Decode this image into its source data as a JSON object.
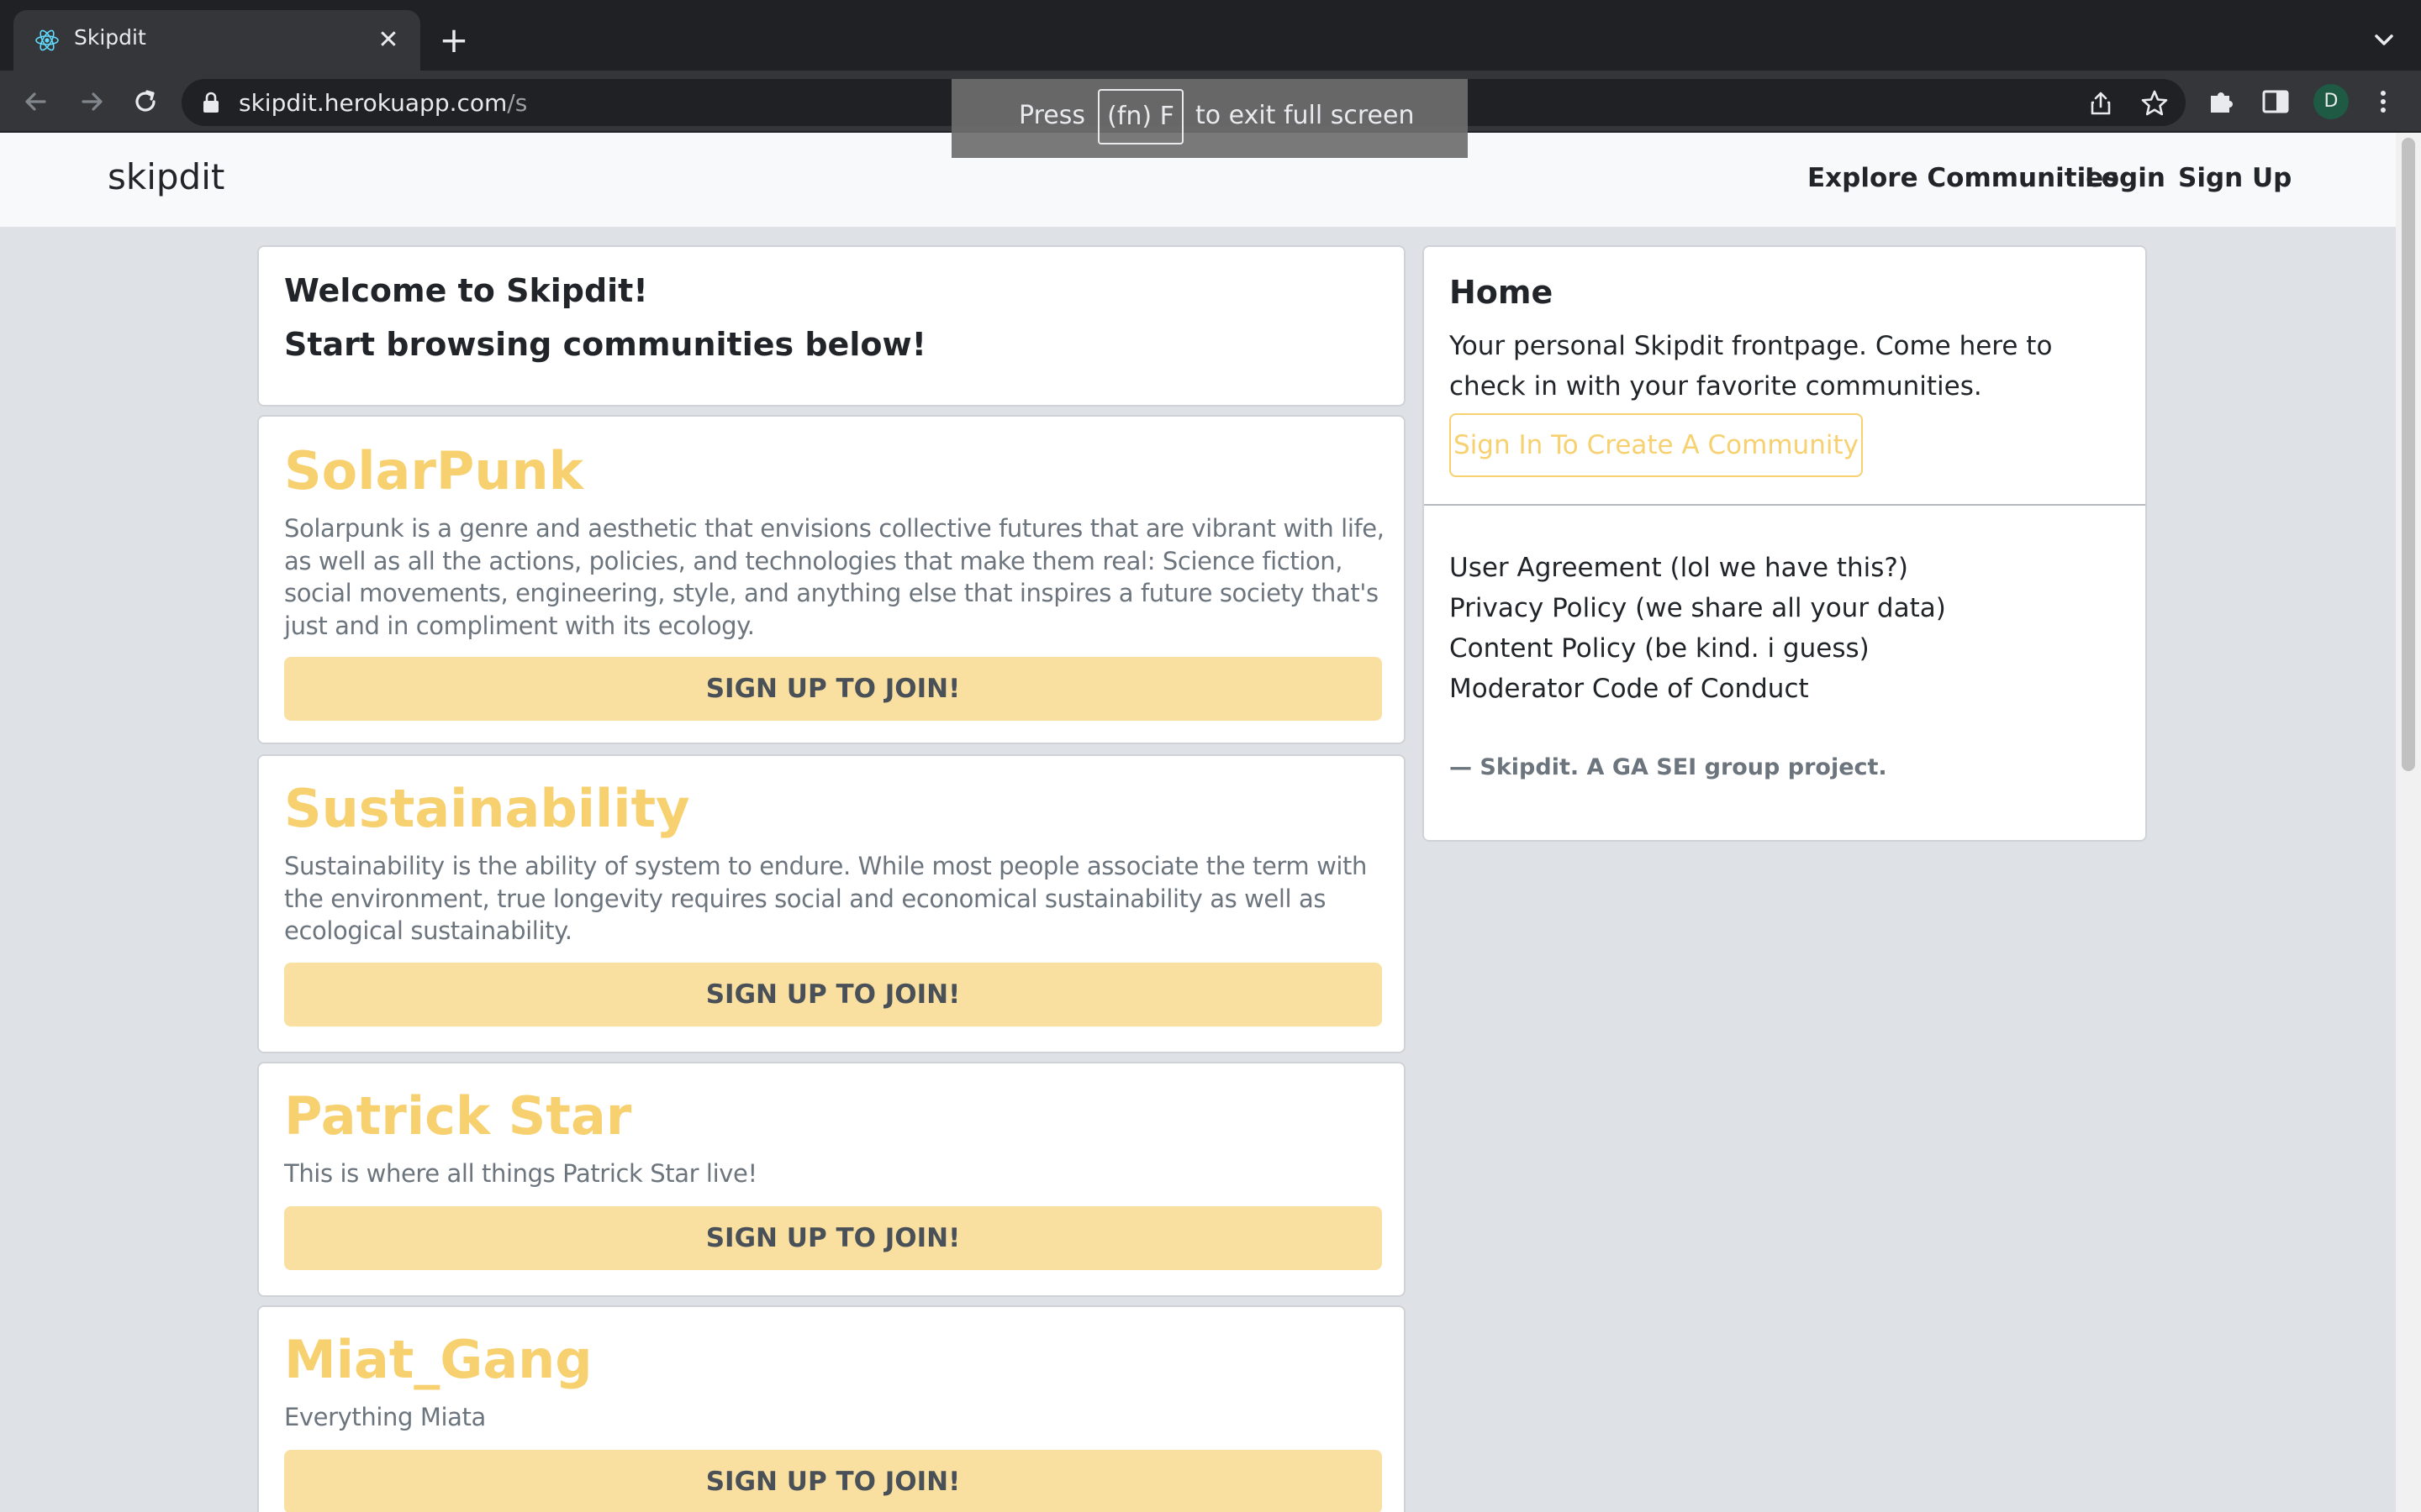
{
  "browser": {
    "tab_title": "Skipdit",
    "url_host": "skipdit.herokuapp.com",
    "url_path": "/s",
    "avatar_letter": "D",
    "fullscreen": {
      "press": "Press",
      "key": "(fn) F",
      "rest": "to exit full screen"
    }
  },
  "navbar": {
    "brand": "skipdit",
    "links": [
      "Explore Communities",
      "Login",
      "Sign Up"
    ]
  },
  "welcome": {
    "line1": "Welcome to Skipdit!",
    "line2": "Start browsing communities below!"
  },
  "communities": [
    {
      "name": "SolarPunk",
      "description": "Solarpunk is a genre and aesthetic that envisions collective futures that are vibrant with life, as well as all the actions, policies, and technologies that make them real: Science fiction, social movements, engineering, style, and anything else that inspires a future society that's just and in compliment with its ecology.",
      "button": "SIGN UP TO JOIN!"
    },
    {
      "name": "Sustainability",
      "description": "Sustainability is the ability of system to endure. While most people associate the term with the environment, true longevity requires social and economical sustainability as well as ecological sustainability.",
      "button": "SIGN UP TO JOIN!"
    },
    {
      "name": "Patrick Star",
      "description": "This is where all things Patrick Star live!",
      "button": "SIGN UP TO JOIN!"
    },
    {
      "name": "Miat_Gang",
      "description": "Everything Miata",
      "button": "SIGN UP TO JOIN!"
    }
  ],
  "sidebar": {
    "title": "Home",
    "description": "Your personal Skipdit frontpage. Come here to check in with your favorite communities.",
    "create_button": "Sign In To Create A Community",
    "links": [
      "User Agreement (lol we have this?)",
      "Privacy Policy (we share all your data)",
      "Content Policy (be kind. i guess)",
      "Moderator Code of Conduct"
    ],
    "footer": "— Skipdit. A GA SEI group project."
  },
  "colors": {
    "accent": "#f7d06f",
    "button_bg": "#fae0a0",
    "page_bg": "#dee2e6"
  }
}
